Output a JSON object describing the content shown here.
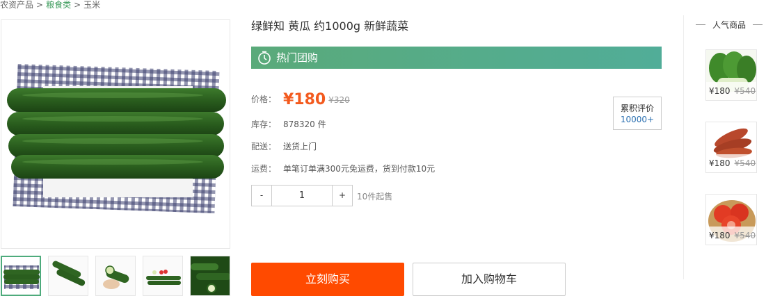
{
  "breadcrumb": {
    "root": "农资产品",
    "category": "粮食类",
    "current": "玉米",
    "separator": ">"
  },
  "product": {
    "title": "绿鲜知 黄瓜 约1000g 新鲜蔬菜",
    "groupbuy_label": "热门团购",
    "price_label": "价格：",
    "price": "¥180",
    "original_price": "¥320",
    "stock_label": "库存：",
    "stock_value": "878320 件",
    "delivery_label": "配送：",
    "delivery_value": "送货上门",
    "fee_label": "运费：",
    "fee_value": "单笔订单满300元免运费，货到付款10元",
    "review_label": "累积评价",
    "review_count": "10000+"
  },
  "quantity": {
    "minus": "-",
    "value": "1",
    "plus": "+",
    "min_note": "10件起售"
  },
  "actions": {
    "buy_now": "立刻购买",
    "add_to_cart": "加入购物车"
  },
  "popular": {
    "title": "人气商品",
    "items": [
      {
        "name": "bok-choy",
        "price": "¥180",
        "original_price": "¥540"
      },
      {
        "name": "sweet-potato",
        "price": "¥180",
        "original_price": "¥540"
      },
      {
        "name": "tomato",
        "price": "¥180",
        "original_price": "¥540"
      }
    ]
  },
  "colors": {
    "accent_green": "#4eab7c",
    "price_orange": "#f35a1e",
    "buy_button": "#ff4a00",
    "review_count_blue": "#2a6fb0"
  },
  "icons": {
    "groupbuy": "stopwatch-icon"
  }
}
